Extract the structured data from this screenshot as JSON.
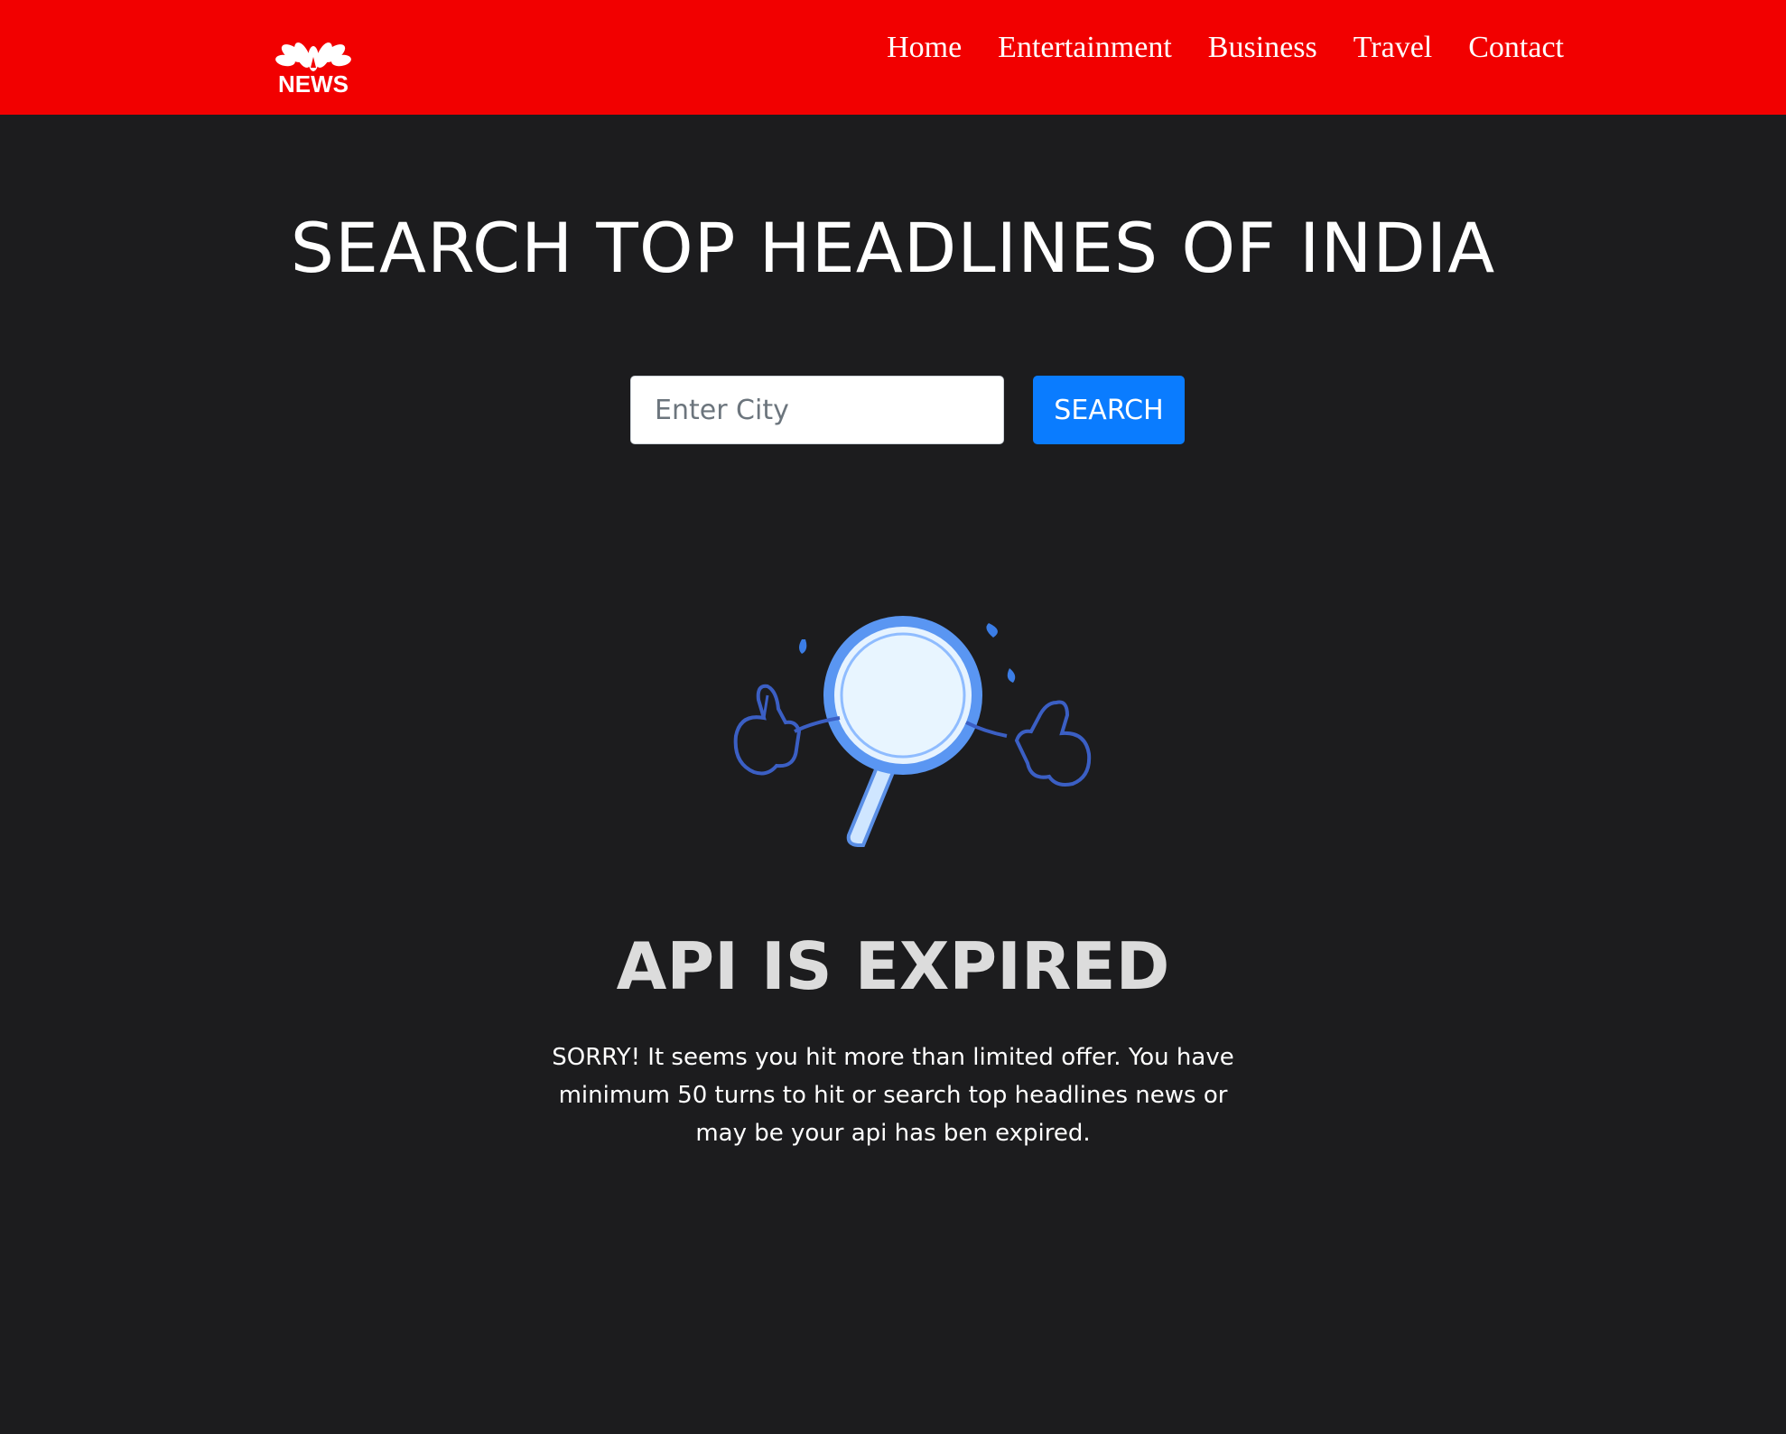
{
  "brand": {
    "logo_text": "NEWS",
    "logo_icon": "peacock-icon",
    "color": "#f20000"
  },
  "nav": {
    "items": [
      {
        "label": "Home"
      },
      {
        "label": "Entertainment"
      },
      {
        "label": "Business"
      },
      {
        "label": "Travel"
      },
      {
        "label": "Contact"
      }
    ]
  },
  "main": {
    "title": "SEARCH TOP HEADLINES OF INDIA",
    "search": {
      "placeholder": "Enter City",
      "value": "",
      "button_label": "SEARCH",
      "button_color": "#0a7cff"
    }
  },
  "error": {
    "illustration": "confused-magnifying-glass-icon",
    "title": "API IS EXPIRED",
    "message": "SORRY! It seems you hit more than limited offer. You have minimum 50 turns to hit or search top headlines news or may be your api has ben expired."
  }
}
